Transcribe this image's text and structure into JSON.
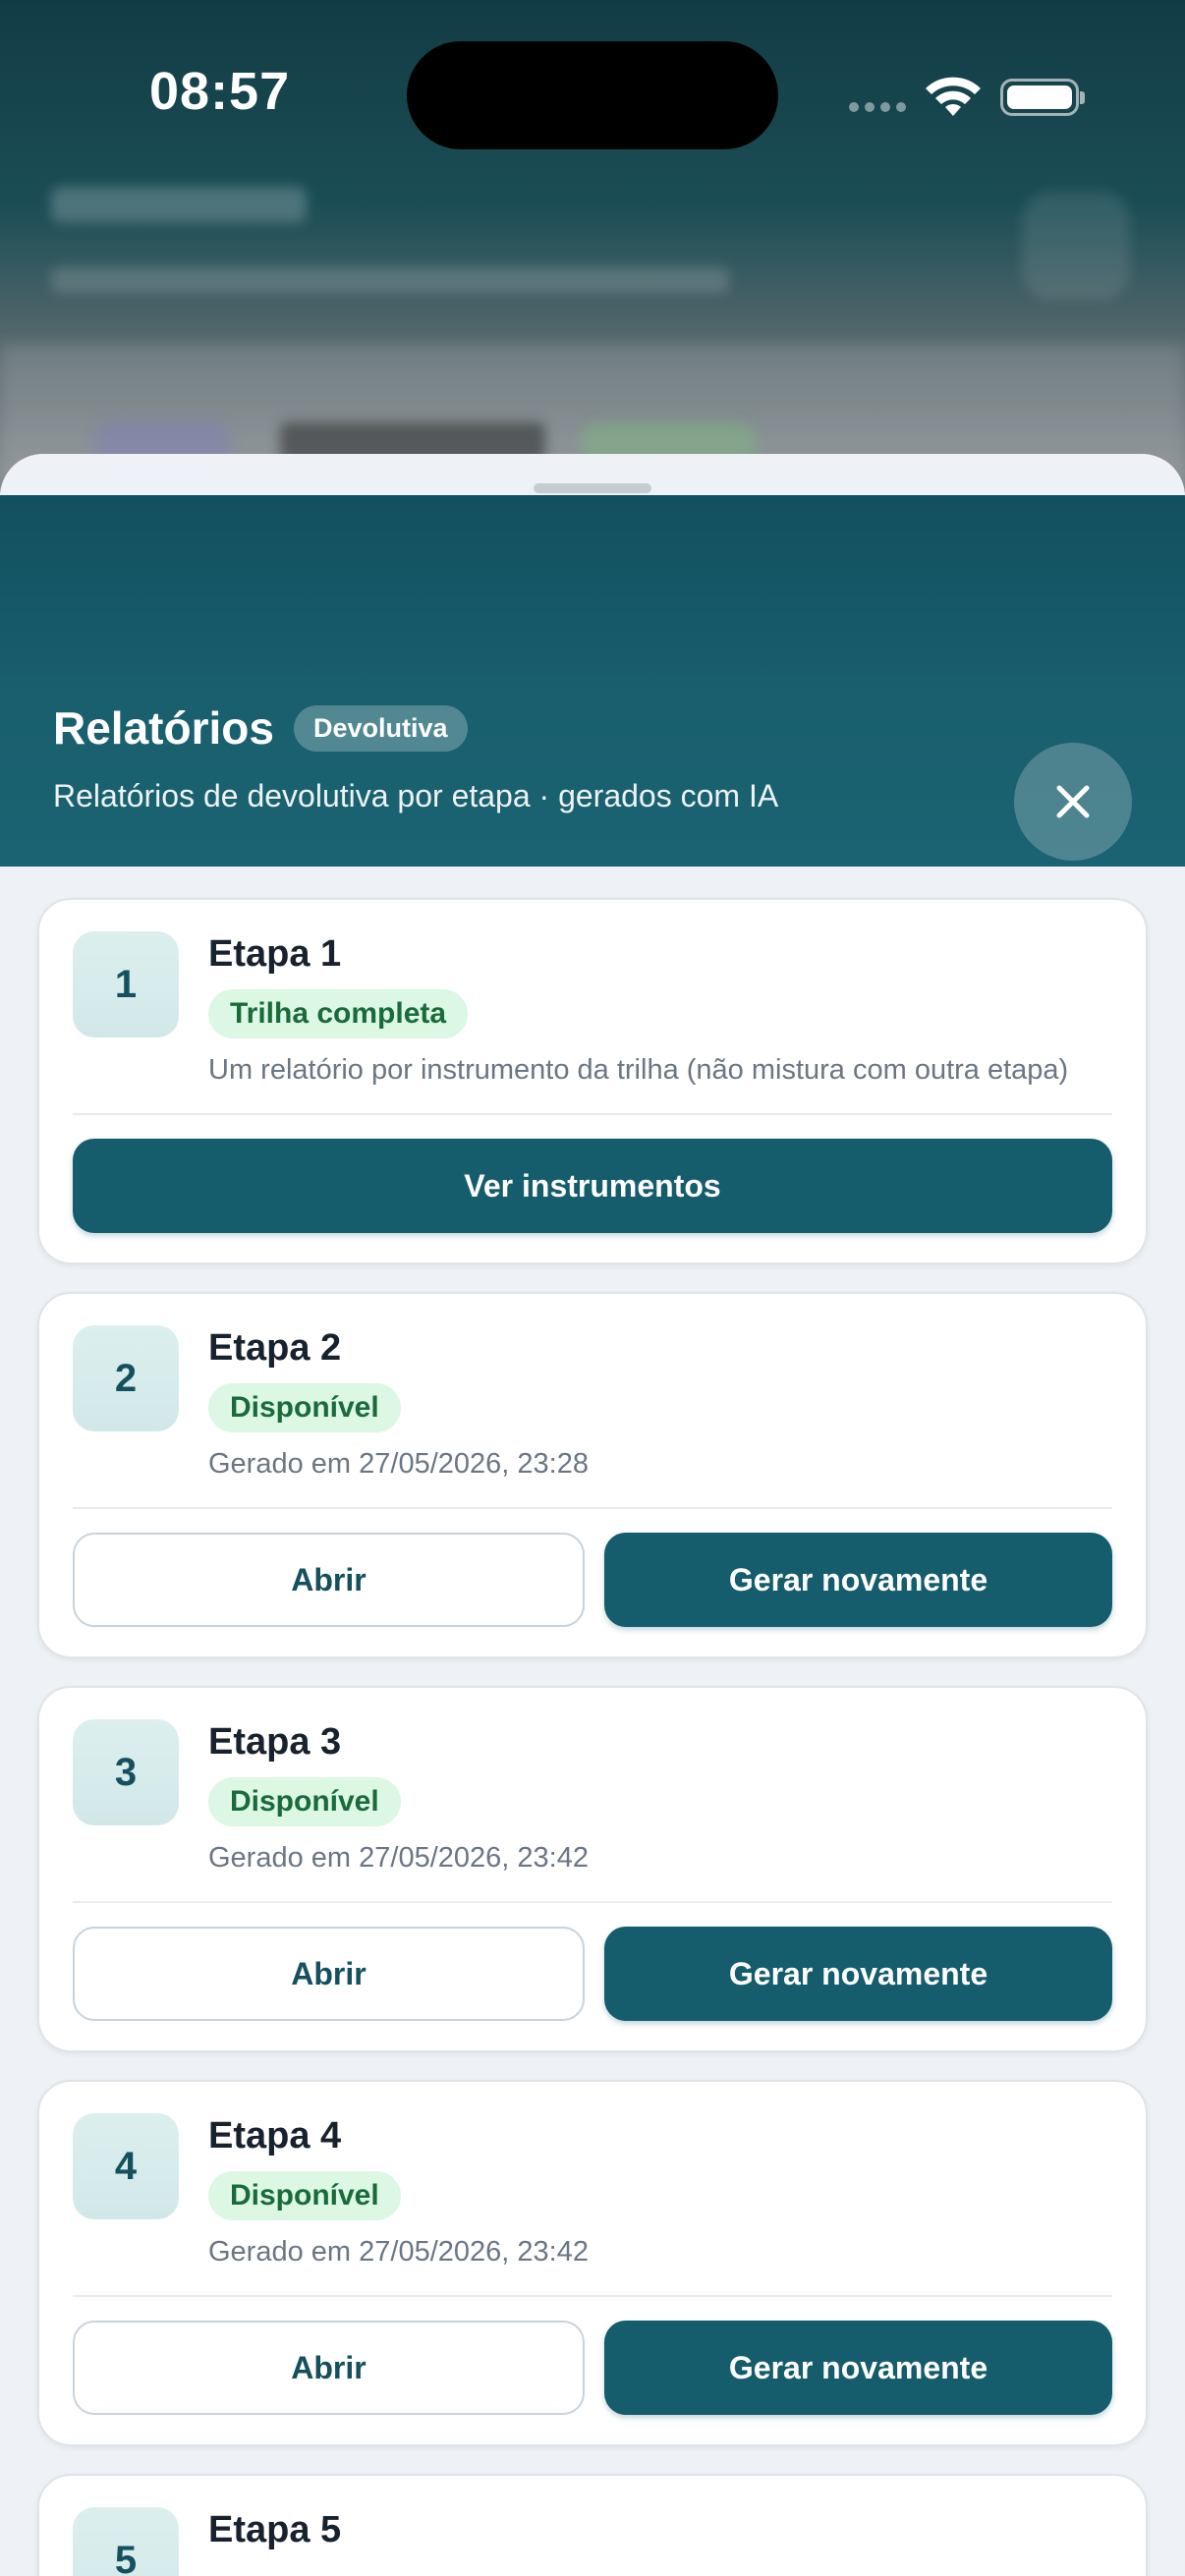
{
  "status_bar": {
    "time": "08:57"
  },
  "sheet": {
    "title": "Relatórios",
    "badge": "Devolutiva",
    "subtitle": "Relatórios de devolutiva por etapa · gerados com IA",
    "close_icon": "close-icon"
  },
  "cards": [
    {
      "number": "1",
      "title": "Etapa 1",
      "status": "Trilha completa",
      "meta": "Um relatório por instrumento da trilha (não mistura com outra etapa)",
      "primary_label": "Ver instrumentos"
    },
    {
      "number": "2",
      "title": "Etapa 2",
      "status": "Disponível",
      "meta": "Gerado em 27/05/2026, 23:28",
      "open_label": "Abrir",
      "regen_label": "Gerar novamente"
    },
    {
      "number": "3",
      "title": "Etapa 3",
      "status": "Disponível",
      "meta": "Gerado em 27/05/2026, 23:42",
      "open_label": "Abrir",
      "regen_label": "Gerar novamente"
    },
    {
      "number": "4",
      "title": "Etapa 4",
      "status": "Disponível",
      "meta": "Gerado em 27/05/2026, 23:42",
      "open_label": "Abrir",
      "regen_label": "Gerar novamente"
    },
    {
      "number": "5",
      "title": "Etapa 5"
    }
  ],
  "colors": {
    "header": "#155c6c",
    "primary_button": "#155c6c",
    "status_pill_bg": "#dcf7e4",
    "status_pill_text": "#1a6a3c"
  }
}
